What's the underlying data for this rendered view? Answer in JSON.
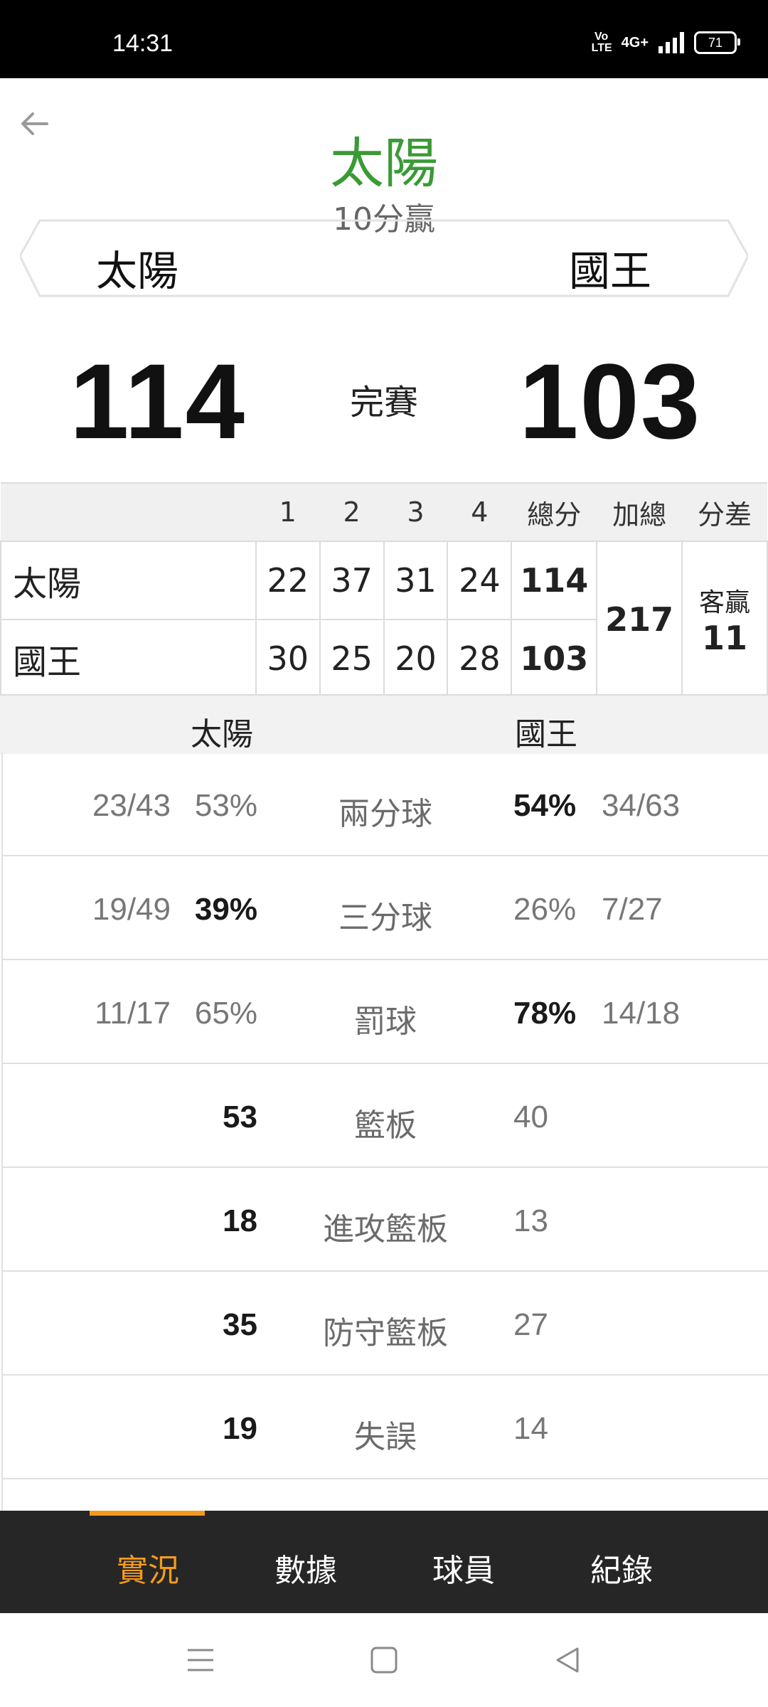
{
  "status": {
    "time": "14:31",
    "volte": "Vo LTE",
    "network": "4G+",
    "battery": "71"
  },
  "header": {
    "leader": "太陽",
    "margin": "10分贏",
    "team_left": "太陽",
    "team_right": "國王"
  },
  "score": {
    "left": "114",
    "right": "103",
    "status": "完賽"
  },
  "quarters": {
    "headers": [
      "1",
      "2",
      "3",
      "4",
      "總分",
      "加總",
      "分差"
    ],
    "rows": [
      {
        "team": "太陽",
        "q": [
          "22",
          "37",
          "31",
          "24"
        ],
        "total": "114"
      },
      {
        "team": "國王",
        "q": [
          "30",
          "25",
          "20",
          "28"
        ],
        "total": "103"
      }
    ],
    "sum": "217",
    "diff_type": "客贏",
    "diff": "11"
  },
  "stats_header": {
    "left": "太陽",
    "right": "國王"
  },
  "stats": [
    {
      "label": "兩分球",
      "left_count": "23/43",
      "left": "53%",
      "right": "54%",
      "right_count": "34/63"
    },
    {
      "label": "三分球",
      "left_count": "19/49",
      "left": "39%",
      "right": "26%",
      "right_count": "7/27"
    },
    {
      "label": "罰球",
      "left_count": "11/17",
      "left": "65%",
      "right": "78%",
      "right_count": "14/18"
    },
    {
      "label": "籃板",
      "left_count": "",
      "left": "53",
      "right": "40",
      "right_count": ""
    },
    {
      "label": "進攻籃板",
      "left_count": "",
      "left": "18",
      "right": "13",
      "right_count": ""
    },
    {
      "label": "防守籃板",
      "left_count": "",
      "left": "35",
      "right": "27",
      "right_count": ""
    },
    {
      "label": "失誤",
      "left_count": "",
      "left": "19",
      "right": "14",
      "right_count": ""
    }
  ],
  "tabs": [
    "實況",
    "數據",
    "球員",
    "紀錄"
  ],
  "colors": {
    "accent": "#f39a1e",
    "leader": "#3a9a35",
    "tabbar": "#262626"
  }
}
